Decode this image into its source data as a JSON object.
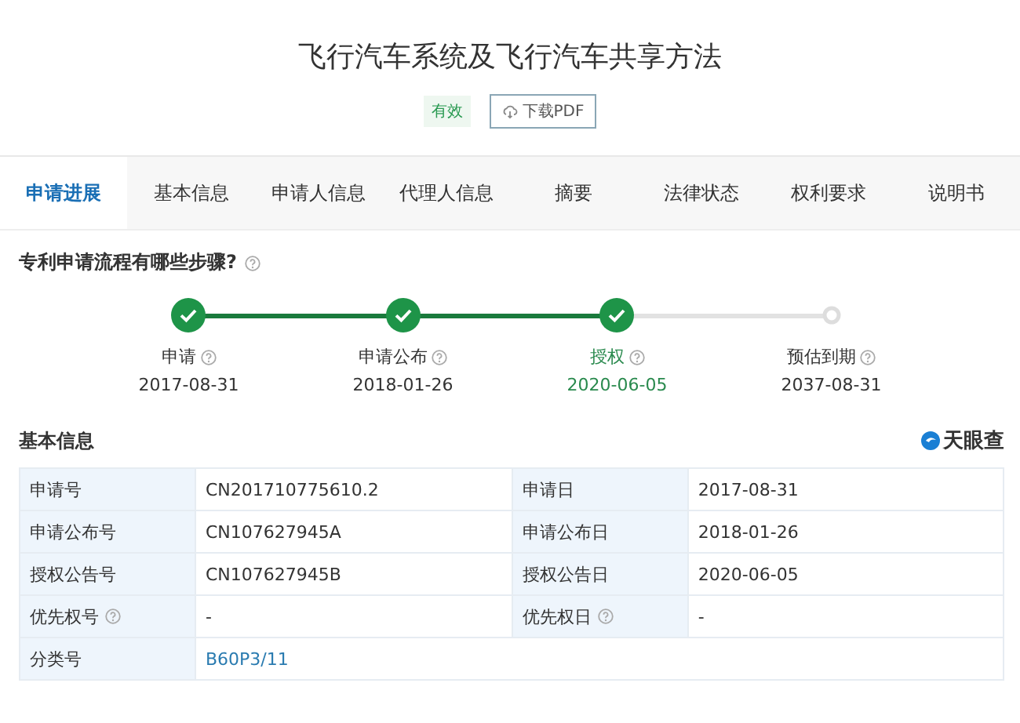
{
  "title": "飞行汽车系统及飞行汽车共享方法",
  "status_tag": "有效",
  "download_button": "下载PDF",
  "tabs": [
    {
      "label": "申请进展",
      "selected": true
    },
    {
      "label": "基本信息",
      "selected": false
    },
    {
      "label": "申请人信息",
      "selected": false
    },
    {
      "label": "代理人信息",
      "selected": false
    },
    {
      "label": "摘要",
      "selected": false
    },
    {
      "label": "法律状态",
      "selected": false
    },
    {
      "label": "权利要求",
      "selected": false
    },
    {
      "label": "说明书",
      "selected": false
    }
  ],
  "process": {
    "heading": "专利申请流程有哪些步骤?",
    "steps": [
      {
        "label": "申请",
        "date": "2017-08-31",
        "done": true,
        "selected": false
      },
      {
        "label": "申请公布",
        "date": "2018-01-26",
        "done": true,
        "selected": false
      },
      {
        "label": "授权",
        "date": "2020-06-05",
        "done": true,
        "selected": true
      },
      {
        "label": "预估到期",
        "date": "2037-08-31",
        "done": false,
        "selected": false
      }
    ]
  },
  "basic_info": {
    "heading": "基本信息",
    "brand": "天眼查",
    "rows": [
      [
        {
          "label": "申请号",
          "value": "CN201710775610.2",
          "help": false,
          "link": false
        },
        {
          "label": "申请日",
          "value": "2017-08-31",
          "help": false,
          "link": false
        }
      ],
      [
        {
          "label": "申请公布号",
          "value": "CN107627945A",
          "help": false,
          "link": false
        },
        {
          "label": "申请公布日",
          "value": "2018-01-26",
          "help": false,
          "link": false
        }
      ],
      [
        {
          "label": "授权公告号",
          "value": "CN107627945B",
          "help": false,
          "link": false
        },
        {
          "label": "授权公告日",
          "value": "2020-06-05",
          "help": false,
          "link": false
        }
      ],
      [
        {
          "label": "优先权号",
          "value": "-",
          "help": true,
          "link": false
        },
        {
          "label": "优先权日",
          "value": "-",
          "help": true,
          "link": false
        }
      ],
      [
        {
          "label": "分类号",
          "value": "B60P3/11",
          "help": false,
          "link": true
        }
      ]
    ]
  }
}
